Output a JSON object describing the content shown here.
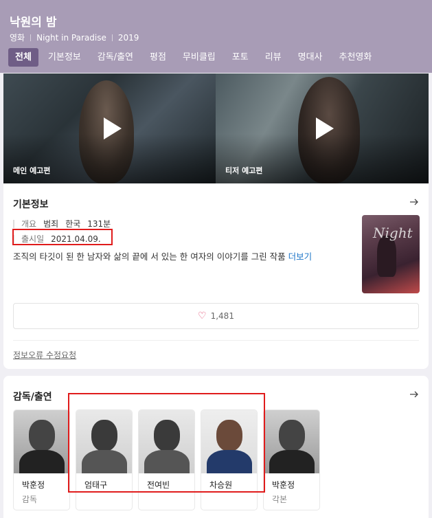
{
  "header": {
    "title": "낙원의 밤",
    "meta": [
      "영화",
      "Night in Paradise",
      "2019"
    ]
  },
  "tabs": [
    {
      "label": "전체",
      "active": true
    },
    {
      "label": "기본정보"
    },
    {
      "label": "감독/출연"
    },
    {
      "label": "평점"
    },
    {
      "label": "무비클립"
    },
    {
      "label": "포토"
    },
    {
      "label": "리뷰"
    },
    {
      "label": "명대사"
    },
    {
      "label": "추천영화"
    }
  ],
  "videos": [
    {
      "label": "메인 예고편",
      "icon": "play-icon"
    },
    {
      "label": "티저 예고편",
      "icon": "play-icon"
    }
  ],
  "info": {
    "title": "기본정보",
    "arrow_icon": "arrow-right-icon",
    "overview_label": "개요",
    "genre": "범죄",
    "country": "한국",
    "runtime": "131분",
    "release_label": "출시일",
    "release_date": "2021.04.09.",
    "synopsis": "조직의 타깃이 된 한 남자와 삶의 끝에 서 있는 한 여자의 이야기를 그린 작품",
    "more_label": "더보기",
    "poster_text": "Night",
    "like_count": "1,481",
    "like_icon": "heart-icon",
    "report_label": "정보오류 수정요청"
  },
  "cast": {
    "title": "감독/출연",
    "arrow_icon": "arrow-right-icon",
    "people": [
      {
        "name": "박훈정",
        "role": "감독"
      },
      {
        "name": "엄태구",
        "role": ""
      },
      {
        "name": "전여빈",
        "role": ""
      },
      {
        "name": "차승원",
        "role": ""
      },
      {
        "name": "박훈정",
        "role": "각본"
      }
    ]
  },
  "colors": {
    "header_bg": "#a89cb6",
    "active_tab": "#6f5d86",
    "highlight": "#e01b1b",
    "link": "#1a73c7"
  }
}
